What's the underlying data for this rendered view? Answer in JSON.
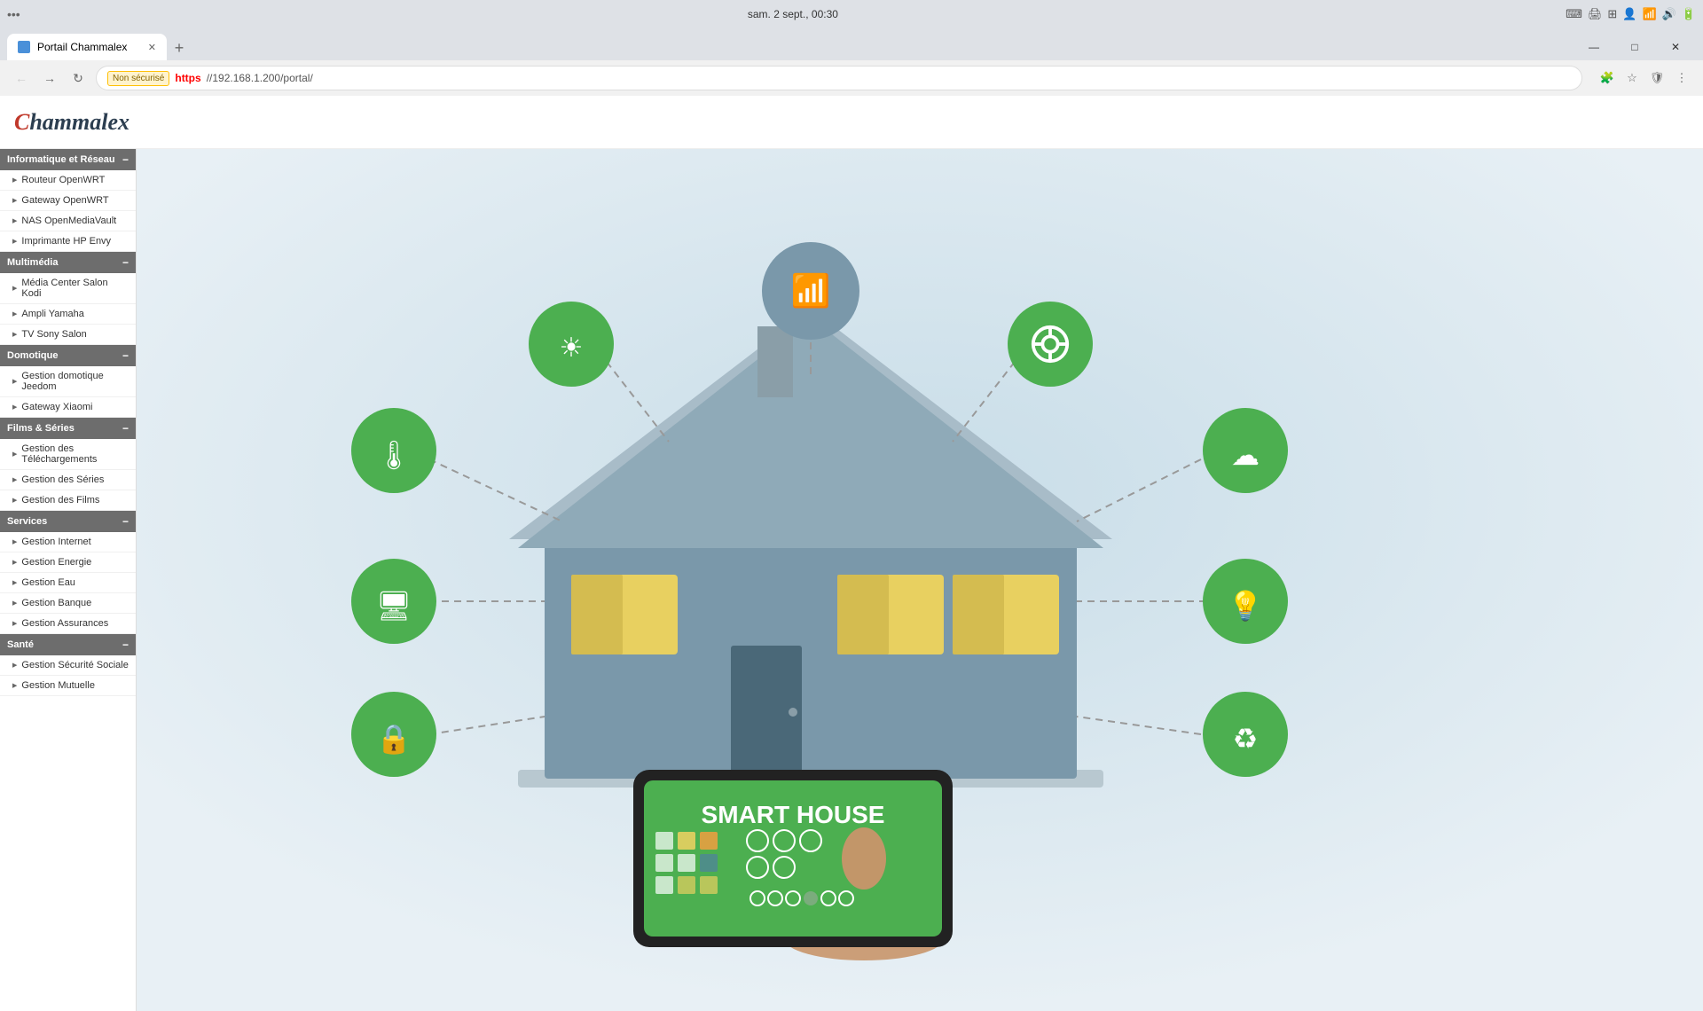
{
  "browser": {
    "title_bar_text": "sam. 2 sept., 00:30",
    "tab_title": "Portail Chammalex",
    "url": "https://192.168.1.200/portal/",
    "url_protocol": "https",
    "insecure_label": "Non sécurisé"
  },
  "header": {
    "logo": "Chammalex"
  },
  "sidebar": {
    "sections": [
      {
        "id": "informatique",
        "label": "Informatique et Réseau",
        "items": [
          "Routeur OpenWRT",
          "Gateway OpenWRT",
          "NAS OpenMediaVault",
          "Imprimante HP Envy"
        ]
      },
      {
        "id": "multimedia",
        "label": "Multimédia",
        "items": [
          "Média Center Salon Kodi",
          "Ampli Yamaha",
          "TV Sony Salon"
        ]
      },
      {
        "id": "domotique",
        "label": "Domotique",
        "items": [
          "Gestion domotique Jeedom",
          "Gateway Xiaomi"
        ]
      },
      {
        "id": "films",
        "label": "Films & Séries",
        "items": [
          "Gestion des Téléchargements",
          "Gestion des Séries",
          "Gestion des Films"
        ]
      },
      {
        "id": "services",
        "label": "Services",
        "items": [
          "Gestion Internet",
          "Gestion Energie",
          "Gestion Eau",
          "Gestion Banque",
          "Gestion Assurances"
        ]
      },
      {
        "id": "sante",
        "label": "Santé",
        "items": [
          "Gestion Sécurité Sociale",
          "Gestion Mutuelle"
        ]
      }
    ]
  },
  "main": {
    "smart_house_label": "SMART HOUSE"
  },
  "icons": {
    "wifi": "📶",
    "solar": "☀",
    "security": "🔒",
    "cloud": "☁",
    "temperature": "🌡",
    "monitor": "🖥",
    "lock": "🔒",
    "recycle": "♻",
    "lightbulb": "💡"
  }
}
